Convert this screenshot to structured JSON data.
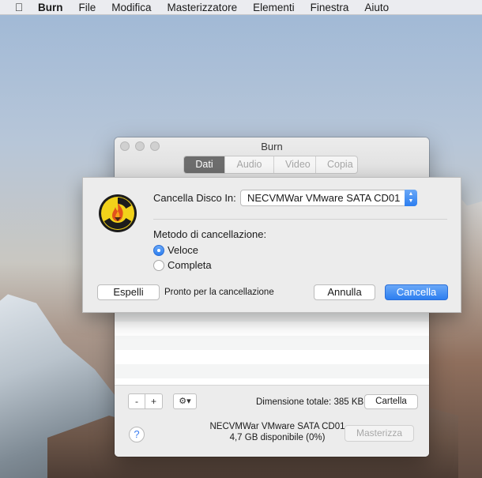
{
  "menubar": {
    "apple_icon": "apple-icon",
    "items": [
      "Burn",
      "File",
      "Modifica",
      "Masterizzatore",
      "Elementi",
      "Finestra",
      "Aiuto"
    ]
  },
  "window": {
    "title": "Burn",
    "tabs": [
      {
        "label": "Dati",
        "active": true
      },
      {
        "label": "Audio",
        "active": false
      },
      {
        "label": "Video",
        "active": false
      },
      {
        "label": "Copia",
        "active": false
      }
    ],
    "bottombar": {
      "minus_label": "-",
      "plus_label": "+",
      "gear_label": "⚙▾",
      "total_size": "Dimensione totale: 385 KB",
      "folder_button": "Cartella",
      "help_label": "?",
      "device_name": "NECVMWar VMware SATA CD01",
      "device_free": "4,7 GB disponibile (0%)",
      "burn_button": "Masterizza"
    }
  },
  "erase_sheet": {
    "icon": "burn-radiation-flame-icon",
    "erase_disk_label": "Cancella Disco In:",
    "device_select_value": "NECVMWar VMware SATA CD01",
    "method_label": "Metodo di cancellazione:",
    "options": [
      {
        "label": "Veloce",
        "selected": true
      },
      {
        "label": "Completa",
        "selected": false
      }
    ],
    "eject_button": "Espelli",
    "status_text": "Pronto per la cancellazione",
    "cancel_button": "Annulla",
    "erase_button": "Cancella"
  },
  "colors": {
    "accent": "#2c7ef0",
    "active_tab": "#6d6d6d"
  }
}
